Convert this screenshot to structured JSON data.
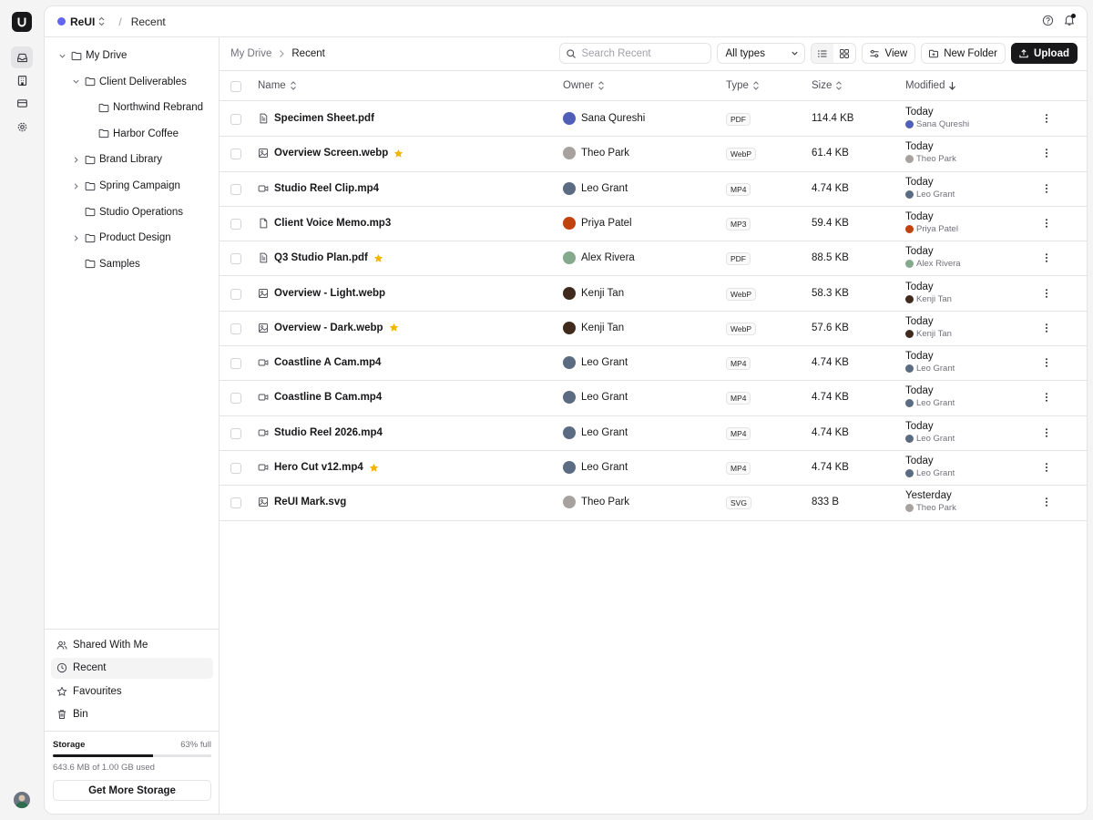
{
  "workspace": {
    "name": "ReUI",
    "dot_color": "#6366f1"
  },
  "top_crumb": "Recent",
  "tree": [
    {
      "label": "My Drive",
      "level": 0,
      "chevron": "down"
    },
    {
      "label": "Client Deliverables",
      "level": 1,
      "chevron": "down"
    },
    {
      "label": "Northwind Rebrand",
      "level": 2,
      "chevron": "none"
    },
    {
      "label": "Harbor Coffee",
      "level": 2,
      "chevron": "none"
    },
    {
      "label": "Brand Library",
      "level": 1,
      "chevron": "right"
    },
    {
      "label": "Spring Campaign",
      "level": 1,
      "chevron": "right"
    },
    {
      "label": "Studio Operations",
      "level": 1,
      "chevron": "none"
    },
    {
      "label": "Product Design",
      "level": 1,
      "chevron": "right"
    },
    {
      "label": "Samples",
      "level": 1,
      "chevron": "none"
    }
  ],
  "nav": [
    {
      "label": "Shared With Me",
      "icon": "users-icon"
    },
    {
      "label": "Recent",
      "icon": "clock-icon",
      "active": true
    },
    {
      "label": "Favourites",
      "icon": "star-icon"
    },
    {
      "label": "Bin",
      "icon": "trash-icon"
    }
  ],
  "storage": {
    "title": "Storage",
    "percent_label": "63% full",
    "fraction": 0.63,
    "used": "643.6 MB of 1.00 GB used",
    "button": "Get More Storage"
  },
  "breadcrumb": {
    "home": "My Drive",
    "current": "Recent"
  },
  "toolbar": {
    "search_placeholder": "Search Recent",
    "type_filter": "All types",
    "view_label": "View",
    "new_folder_label": "New Folder",
    "upload_label": "Upload"
  },
  "columns": {
    "name": "Name",
    "owner": "Owner",
    "type": "Type",
    "size": "Size",
    "modified": "Modified"
  },
  "owners": {
    "Sana Qureshi": "#4f5fb8",
    "Theo Park": "#a8a29e",
    "Leo Grant": "#5b6b82",
    "Priya Patel": "#c2410c",
    "Alex Rivera": "#84a98c",
    "Kenji Tan": "#3f2a1d"
  },
  "rows": [
    {
      "name": "Specimen Sheet.pdf",
      "icon": "file-text-icon",
      "starred": false,
      "owner": "Sana Qureshi",
      "type": "PDF",
      "size": "114.4 KB",
      "modified": "Today"
    },
    {
      "name": "Overview Screen.webp",
      "icon": "image-icon",
      "starred": true,
      "owner": "Theo Park",
      "type": "WebP",
      "size": "61.4 KB",
      "modified": "Today"
    },
    {
      "name": "Studio Reel Clip.mp4",
      "icon": "video-icon",
      "starred": false,
      "owner": "Leo Grant",
      "type": "MP4",
      "size": "4.74 KB",
      "modified": "Today"
    },
    {
      "name": "Client Voice Memo.mp3",
      "icon": "file-icon",
      "starred": false,
      "owner": "Priya Patel",
      "type": "MP3",
      "size": "59.4 KB",
      "modified": "Today"
    },
    {
      "name": "Q3 Studio Plan.pdf",
      "icon": "file-text-icon",
      "starred": true,
      "owner": "Alex Rivera",
      "type": "PDF",
      "size": "88.5 KB",
      "modified": "Today"
    },
    {
      "name": "Overview - Light.webp",
      "icon": "image-icon",
      "starred": false,
      "owner": "Kenji Tan",
      "type": "WebP",
      "size": "58.3 KB",
      "modified": "Today"
    },
    {
      "name": "Overview - Dark.webp",
      "icon": "image-icon",
      "starred": true,
      "owner": "Kenji Tan",
      "type": "WebP",
      "size": "57.6 KB",
      "modified": "Today"
    },
    {
      "name": "Coastline A Cam.mp4",
      "icon": "video-icon",
      "starred": false,
      "owner": "Leo Grant",
      "type": "MP4",
      "size": "4.74 KB",
      "modified": "Today"
    },
    {
      "name": "Coastline B Cam.mp4",
      "icon": "video-icon",
      "starred": false,
      "owner": "Leo Grant",
      "type": "MP4",
      "size": "4.74 KB",
      "modified": "Today"
    },
    {
      "name": "Studio Reel 2026.mp4",
      "icon": "video-icon",
      "starred": false,
      "owner": "Leo Grant",
      "type": "MP4",
      "size": "4.74 KB",
      "modified": "Today"
    },
    {
      "name": "Hero Cut v12.mp4",
      "icon": "video-icon",
      "starred": true,
      "owner": "Leo Grant",
      "type": "MP4",
      "size": "4.74 KB",
      "modified": "Today"
    },
    {
      "name": "ReUI Mark.svg",
      "icon": "image-icon",
      "starred": false,
      "owner": "Theo Park",
      "type": "SVG",
      "size": "833 B",
      "modified": "Yesterday"
    }
  ],
  "colors": {
    "star": "#f5b400",
    "primary": "#18181b"
  }
}
